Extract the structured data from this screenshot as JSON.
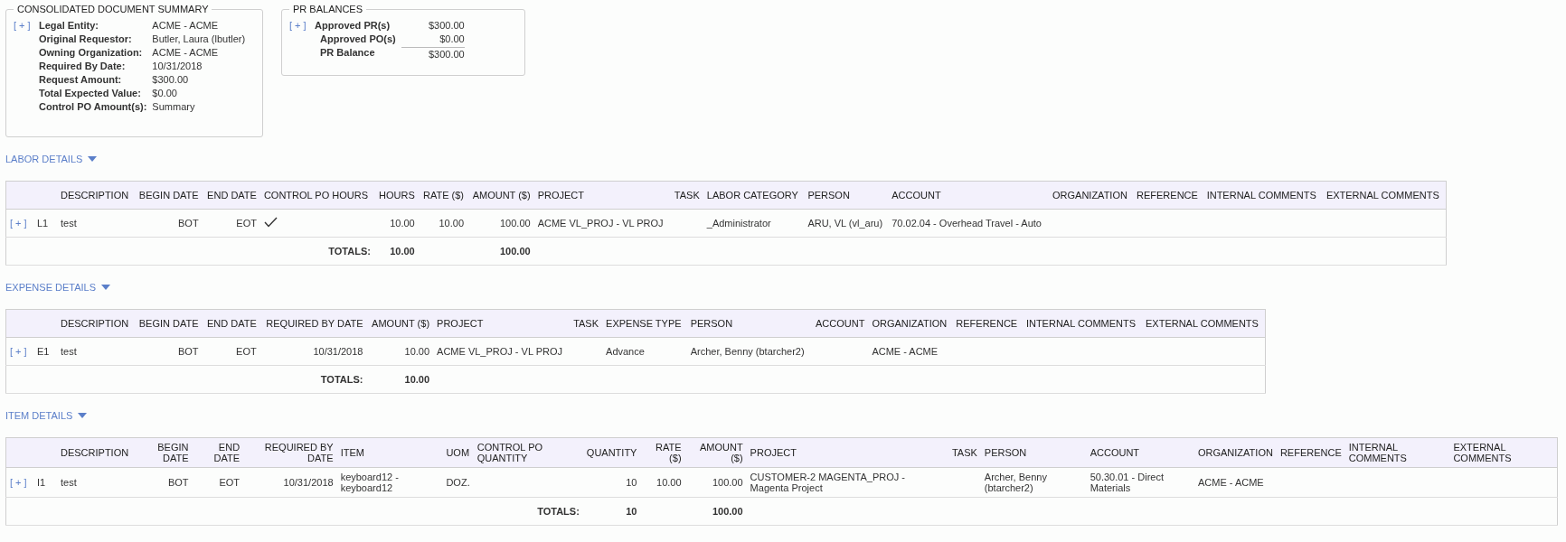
{
  "summary": {
    "title": "CONSOLIDATED DOCUMENT SUMMARY",
    "expand": "[ + ]",
    "fields": [
      {
        "label": "Legal Entity:",
        "value": "ACME - ACME"
      },
      {
        "label": "Original Requestor:",
        "value": "Butler, Laura (lbutler)"
      },
      {
        "label": "Owning Organization:",
        "value": "ACME - ACME"
      },
      {
        "label": "Required By Date:",
        "value": "10/31/2018"
      },
      {
        "label": "Request Amount:",
        "value": "$300.00"
      },
      {
        "label": "Total Expected Value:",
        "value": "$0.00"
      },
      {
        "label": "Control PO Amount(s):",
        "value": "Summary"
      }
    ]
  },
  "pr_balances": {
    "title": "PR BALANCES",
    "expand": "[ + ]",
    "rows": [
      {
        "label": "Approved PR(s)",
        "value": "$300.00",
        "kind": "plain"
      },
      {
        "label": "Approved PO(s)",
        "value": "$0.00",
        "kind": "plain"
      },
      {
        "label": "PR Balance",
        "value": "$300.00",
        "kind": "total"
      }
    ]
  },
  "sections": [
    {
      "title": "LABOR DETAILS",
      "expanded": true,
      "totals_label": "TOTALS:",
      "columns": [
        {
          "label": "DESCRIPTION",
          "kind": "text"
        },
        {
          "label": "BEGIN DATE",
          "kind": "number"
        },
        {
          "label": "END DATE",
          "kind": "number"
        },
        {
          "label": "CONTROL PO HOURS",
          "kind": "check"
        },
        {
          "label": "HOURS",
          "kind": "number",
          "total": "10.00"
        },
        {
          "label": "RATE ($)",
          "kind": "number"
        },
        {
          "label": "AMOUNT ($)",
          "kind": "number",
          "total": "100.00"
        },
        {
          "label": "PROJECT",
          "kind": "text"
        },
        {
          "label": "TASK",
          "kind": "number"
        },
        {
          "label": "LABOR CATEGORY",
          "kind": "text"
        },
        {
          "label": "PERSON",
          "kind": "text"
        },
        {
          "label": "ACCOUNT",
          "kind": "text"
        },
        {
          "label": "ORGANIZATION",
          "kind": "text"
        },
        {
          "label": "REFERENCE",
          "kind": "text"
        },
        {
          "label": "INTERNAL COMMENTS",
          "kind": "text"
        },
        {
          "label": "EXTERNAL COMMENTS",
          "kind": "text"
        }
      ],
      "rows": [
        {
          "expand": "[ + ]",
          "line": "L1",
          "cells": [
            "test",
            "BOT",
            "EOT",
            true,
            "10.00",
            "10.00",
            "100.00",
            "ACME VL_PROJ - VL PROJ",
            null,
            "_Administrator",
            "ARU, VL (vl_aru)",
            "70.02.04 - Overhead Travel - Auto",
            null,
            null,
            null,
            null
          ]
        }
      ]
    },
    {
      "title": "EXPENSE DETAILS",
      "expanded": true,
      "totals_label": "TOTALS:",
      "columns": [
        {
          "label": "DESCRIPTION",
          "kind": "text"
        },
        {
          "label": "BEGIN DATE",
          "kind": "number"
        },
        {
          "label": "END DATE",
          "kind": "number"
        },
        {
          "label": "REQUIRED BY DATE",
          "kind": "number"
        },
        {
          "label": "AMOUNT ($)",
          "kind": "number",
          "total": "10.00"
        },
        {
          "label": "PROJECT",
          "kind": "text"
        },
        {
          "label": "TASK",
          "kind": "number"
        },
        {
          "label": "EXPENSE TYPE",
          "kind": "text"
        },
        {
          "label": "PERSON",
          "kind": "text"
        },
        {
          "label": "ACCOUNT",
          "kind": "number"
        },
        {
          "label": "ORGANIZATION",
          "kind": "text"
        },
        {
          "label": "REFERENCE",
          "kind": "text"
        },
        {
          "label": "INTERNAL COMMENTS",
          "kind": "text"
        },
        {
          "label": "EXTERNAL COMMENTS",
          "kind": "text"
        }
      ],
      "rows": [
        {
          "expand": "[ + ]",
          "line": "E1",
          "cells": [
            "test",
            "BOT",
            "EOT",
            "10/31/2018",
            "10.00",
            "ACME VL_PROJ - VL PROJ",
            null,
            "Advance",
            "Archer, Benny (btarcher2)",
            null,
            "ACME - ACME",
            null,
            null,
            null
          ]
        }
      ]
    },
    {
      "title": "ITEM DETAILS",
      "expanded": true,
      "totals_label": "TOTALS:",
      "columns": [
        {
          "label": "DESCRIPTION",
          "kind": "text"
        },
        {
          "label": "BEGIN DATE",
          "kind": "number"
        },
        {
          "label": "END DATE",
          "kind": "number"
        },
        {
          "label": "REQUIRED BY DATE",
          "kind": "number"
        },
        {
          "label": "ITEM",
          "kind": "text"
        },
        {
          "label": "UOM",
          "kind": "text"
        },
        {
          "label": "CONTROL PO QUANTITY",
          "kind": "text"
        },
        {
          "label": "QUANTITY",
          "kind": "number",
          "total": "10"
        },
        {
          "label": "RATE ($)",
          "kind": "number"
        },
        {
          "label": "AMOUNT ($)",
          "kind": "number",
          "total": "100.00"
        },
        {
          "label": "PROJECT",
          "kind": "text"
        },
        {
          "label": "TASK",
          "kind": "number"
        },
        {
          "label": "PERSON",
          "kind": "text"
        },
        {
          "label": "ACCOUNT",
          "kind": "text"
        },
        {
          "label": "ORGANIZATION",
          "kind": "text"
        },
        {
          "label": "REFERENCE",
          "kind": "text"
        },
        {
          "label": "INTERNAL COMMENTS",
          "kind": "text"
        },
        {
          "label": "EXTERNAL COMMENTS",
          "kind": "text"
        }
      ],
      "rows": [
        {
          "expand": "[ + ]",
          "line": "I1",
          "cells": [
            "test",
            "BOT",
            "EOT",
            "10/31/2018",
            "keyboard12 - keyboard12",
            "DOZ.",
            null,
            "10",
            "10.00",
            "100.00",
            "CUSTOMER-2 MAGENTA_PROJ - Magenta Project",
            null,
            "Archer, Benny (btarcher2)",
            "50.30.01 - Direct Materials",
            "ACME - ACME",
            null,
            null,
            null
          ]
        }
      ]
    }
  ]
}
